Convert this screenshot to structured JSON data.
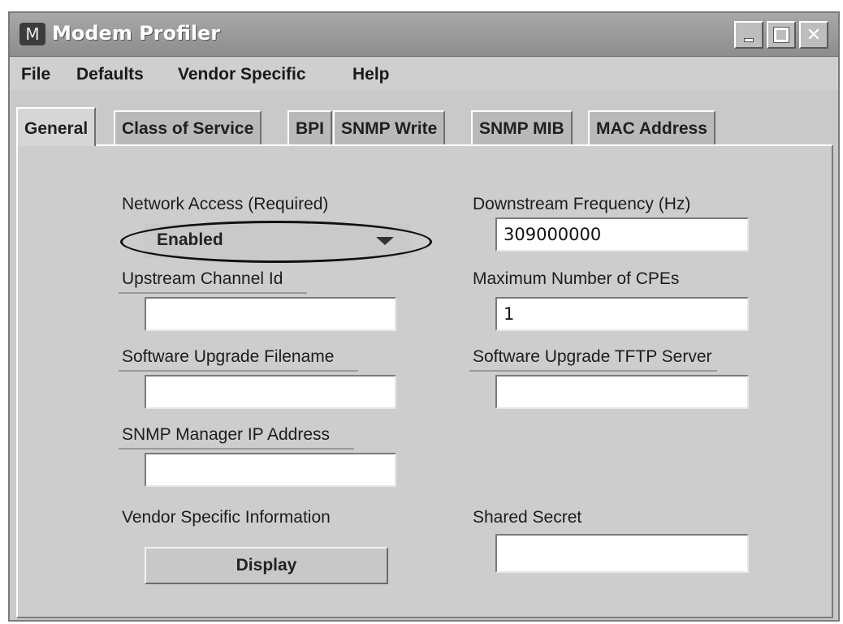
{
  "window": {
    "title": "Modem Profiler",
    "app_icon_glyph": "M",
    "controls": [
      "minimize",
      "maximize",
      "close"
    ]
  },
  "menu": [
    "File",
    "Defaults",
    "Vendor Specific",
    "Help"
  ],
  "tabs": [
    "General",
    "Class of Service",
    "BPI",
    "SNMP Write",
    "SNMP MIB",
    "MAC Address"
  ],
  "active_tab": "General",
  "form": {
    "network_access": {
      "label": "Network Access (Required)",
      "value": "Enabled"
    },
    "downstream_frequency": {
      "label": "Downstream Frequency (Hz)",
      "value": "309000000"
    },
    "upstream_channel": {
      "label": "Upstream Channel Id",
      "value": ""
    },
    "max_cpes": {
      "label": "Maximum Number of CPEs",
      "value": "1"
    },
    "sw_upgrade_filename": {
      "label": "Software Upgrade Filename",
      "value": ""
    },
    "sw_upgrade_tftp": {
      "label": "Software Upgrade TFTP Server",
      "value": ""
    },
    "snmp_manager_ip": {
      "label": "SNMP Manager IP Address",
      "value": ""
    },
    "vendor_specific": {
      "label": "Vendor Specific Information",
      "button": "Display"
    },
    "shared_secret": {
      "label": "Shared Secret",
      "value": ""
    }
  },
  "colors": {
    "titlebar": "#9a9a9a",
    "window_bg": "#c9c9c9",
    "field_bg": "#ffffff",
    "annotation_ellipse": "#111111"
  },
  "icons": {
    "app": "motorola-logo-icon",
    "minimize": "minimize-icon",
    "maximize": "maximize-icon",
    "close": "close-icon",
    "dropdown": "dropdown-arrow-icon"
  }
}
